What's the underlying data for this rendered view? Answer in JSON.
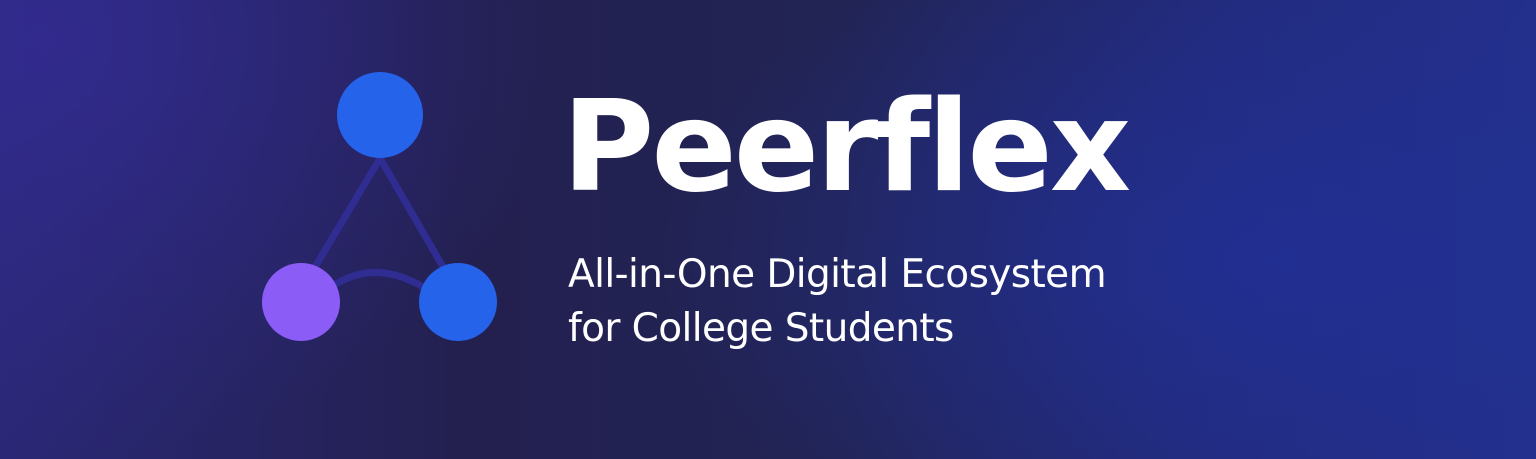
{
  "brand": {
    "name": "Peerflex",
    "tagline_line1": "All-in-One Digital Ecosystem",
    "tagline_line2": "for College Students"
  },
  "logo": {
    "icon": "network-nodes-icon",
    "colors": {
      "top_node": "#2563eb",
      "left_node": "#8b5cf6",
      "right_node": "#2563eb",
      "connector": "#2f2d92"
    }
  },
  "colors": {
    "background_dark": "#222454",
    "background_accent": "#23308a",
    "text": "#ffffff"
  }
}
